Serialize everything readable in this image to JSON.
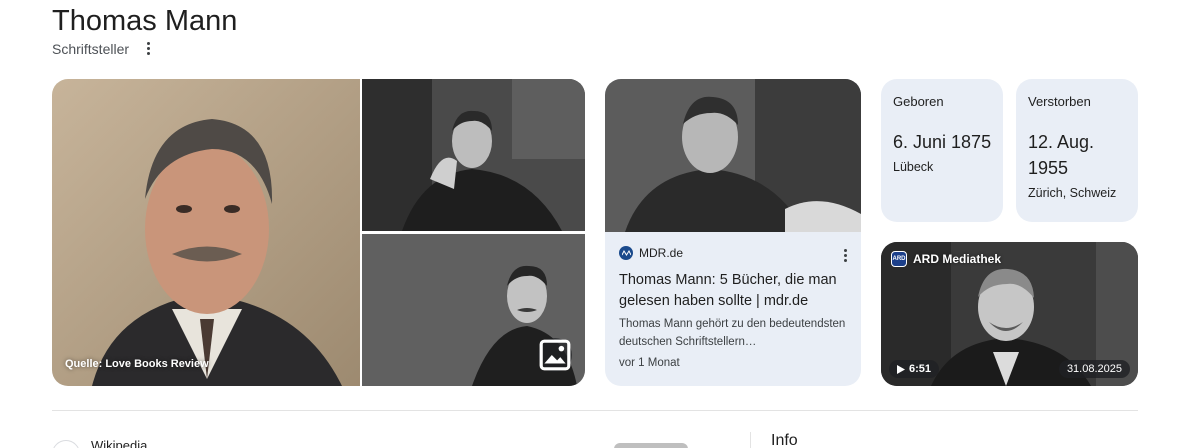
{
  "entity": {
    "title": "Thomas Mann",
    "subtitle": "Schriftsteller",
    "more_icon": "more-vert-icon"
  },
  "images": {
    "main_caption": "Quelle: Love Books Review",
    "image_search_icon": "image-icon"
  },
  "news": {
    "source": "MDR.de",
    "title": "Thomas Mann: 5 Bücher, die man gelesen haben sollte | mdr.de",
    "snippet": "Thomas Mann gehört zu den bedeutendsten deutschen Schriftstellern…",
    "date": "vor 1 Monat"
  },
  "facts": {
    "born": {
      "label": "Geboren",
      "value": "6. Juni 1875",
      "place": "Lübeck"
    },
    "died": {
      "label": "Verstorben",
      "value": "12. Aug. 1955",
      "place": "Zürich, Schweiz"
    }
  },
  "video": {
    "source": "ARD Mediathek",
    "logo_text": "ARD",
    "duration": "6:51",
    "date": "31.08.2025",
    "play_icon": "play-icon"
  },
  "below": {
    "source_label": "Wikipedia",
    "info_heading": "Info"
  },
  "colors": {
    "card_bg": "#e9eef6",
    "text": "#1f1f1f",
    "secondary_text": "#4d5156",
    "divider": "#e3e3e3"
  }
}
